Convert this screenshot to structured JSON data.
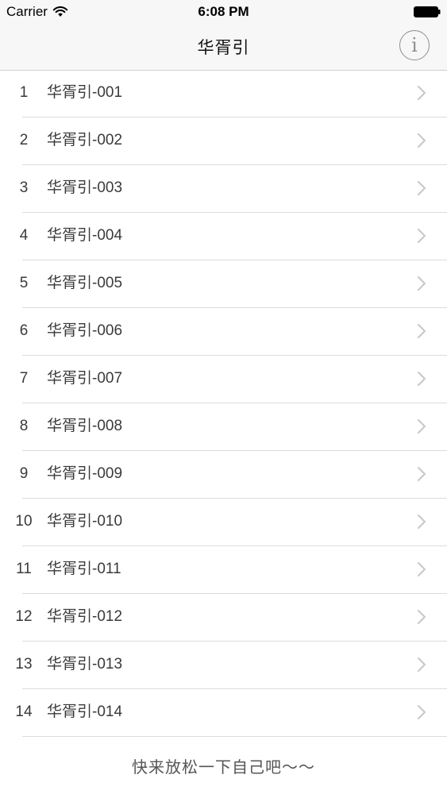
{
  "status_bar": {
    "carrier": "Carrier",
    "time": "6:08 PM"
  },
  "nav": {
    "title": "华胥引",
    "info_glyph": "i"
  },
  "list": {
    "items": [
      {
        "index": "1",
        "label": "华胥引-001"
      },
      {
        "index": "2",
        "label": "华胥引-002"
      },
      {
        "index": "3",
        "label": "华胥引-003"
      },
      {
        "index": "4",
        "label": "华胥引-004"
      },
      {
        "index": "5",
        "label": "华胥引-005"
      },
      {
        "index": "6",
        "label": "华胥引-006"
      },
      {
        "index": "7",
        "label": "华胥引-007"
      },
      {
        "index": "8",
        "label": "华胥引-008"
      },
      {
        "index": "9",
        "label": "华胥引-009"
      },
      {
        "index": "10",
        "label": "华胥引-010"
      },
      {
        "index": "11",
        "label": "华胥引-011"
      },
      {
        "index": "12",
        "label": "华胥引-012"
      },
      {
        "index": "13",
        "label": "华胥引-013"
      },
      {
        "index": "14",
        "label": "华胥引-014"
      }
    ]
  },
  "footer": {
    "text": "快来放松一下自己吧～～"
  },
  "icons": {
    "wifi": "wifi-icon",
    "battery": "battery-icon",
    "info": "info-icon",
    "chevron": "chevron-right-icon"
  },
  "colors": {
    "nav_background": "#f7f7f7",
    "separator": "#dcdcdf",
    "chevron": "#c7c7cc",
    "text": "#3a3a3a"
  }
}
